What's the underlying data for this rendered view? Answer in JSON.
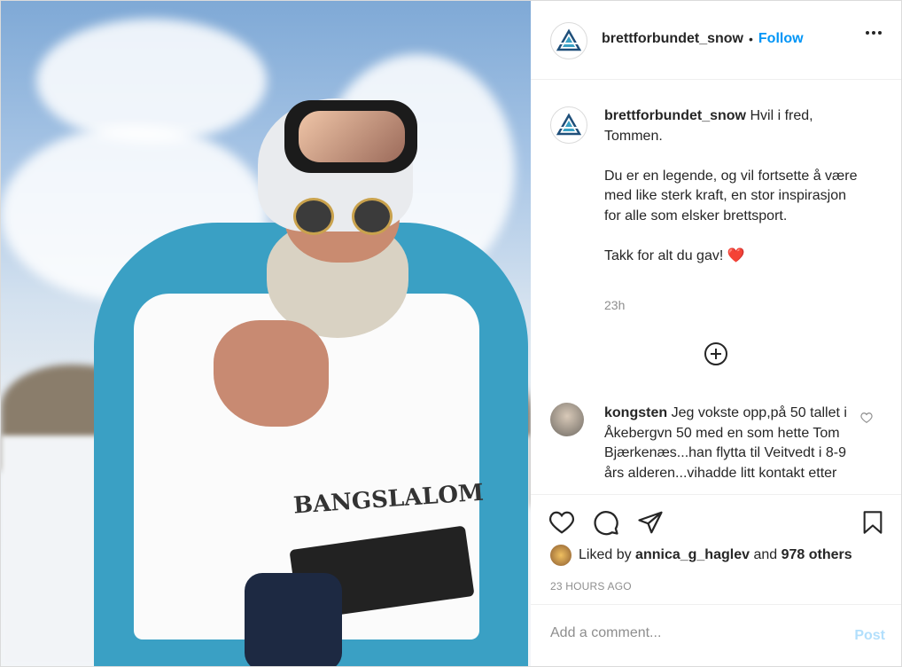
{
  "header": {
    "username": "brettforbundet_snow",
    "separator": "•",
    "follow_label": "Follow"
  },
  "caption": {
    "username": "brettforbundet_snow",
    "text": "Hvil i fred,\nTommen.\n\nDu er en legende, og vil fortsette å være med like sterk kraft, en stor inspirasjon for alle som elsker brettsport.\n\nTakk for alt du gav! ❤️",
    "time": "23h"
  },
  "photo": {
    "bib_text": "BANGSLALOM"
  },
  "comments": [
    {
      "username": "kongsten",
      "text": "Jeg vokste opp,på 50 tallet i Åkebergvn 50 med en som hette Tom Bjærkenæs...han flytta til Veitvedt i 8-9 års alderen...vihadde litt kontakt etter"
    }
  ],
  "likes": {
    "user": "annica_g_haglev",
    "connector": "and",
    "others": "978 others",
    "prefix": "Liked by"
  },
  "post_time": "23 HOURS AGO",
  "add_comment": {
    "placeholder": "Add a comment...",
    "post_label": "Post"
  },
  "colors": {
    "accent": "#0095f6",
    "heart": "#ed4956",
    "jacket": "#3aa0c4"
  }
}
